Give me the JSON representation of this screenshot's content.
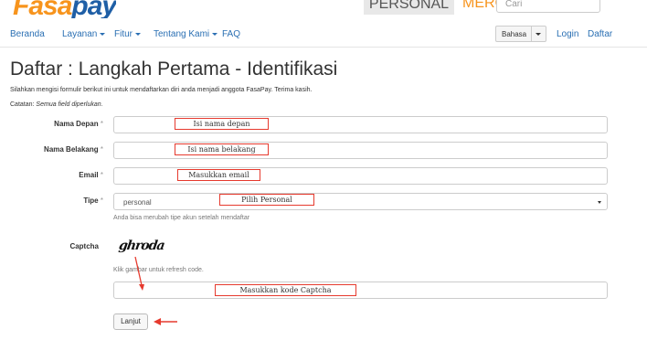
{
  "brand": {
    "logo_part1": "Fasa",
    "logo_part2": "pay"
  },
  "topnav": {
    "personal": "PERSONAL",
    "merchant": "MERCHANT",
    "search_placeholder": "Cari"
  },
  "nav": {
    "items": [
      "Beranda",
      "Layanan",
      "Fitur",
      "Tentang Kami",
      "FAQ"
    ],
    "dropdown_flags": [
      false,
      true,
      true,
      true,
      false
    ],
    "language": "Bahasa",
    "login": "Login",
    "register": "Daftar"
  },
  "page": {
    "title": "Daftar : Langkah Pertama - Identifikasi",
    "intro": "Silahkan mengisi formulir berikut ini untuk mendaftarkan diri anda menjadi anggota FasaPay. Terima kasih.",
    "note_prefix": "Catatan: ",
    "note_text": "Semua field diperlukan."
  },
  "form": {
    "required_mark": "*",
    "first_name": {
      "label": "Nama Depan",
      "value": "",
      "annotation": "Isi nama depan"
    },
    "last_name": {
      "label": "Nama Belakang",
      "value": "",
      "annotation": "Isi nama belakang"
    },
    "email": {
      "label": "Email",
      "value": "",
      "annotation": "Masukkan email"
    },
    "type": {
      "label": "Tipe",
      "value": "personal",
      "annotation": "Pilih Personal",
      "help": "Anda bisa merubah tipe akun setelah mendaftar"
    },
    "captcha": {
      "label": "Captcha",
      "image_text": "ghroda",
      "help": "Klik gambar untuk refresh code.",
      "value": "",
      "annotation": "Masukkan kode Captcha"
    },
    "submit": "Lanjut"
  },
  "colors": {
    "annotation_red": "#e63a2e",
    "link_blue": "#2a6fb3",
    "brand_orange": "#f7941d",
    "brand_blue": "#1f5fa6"
  }
}
